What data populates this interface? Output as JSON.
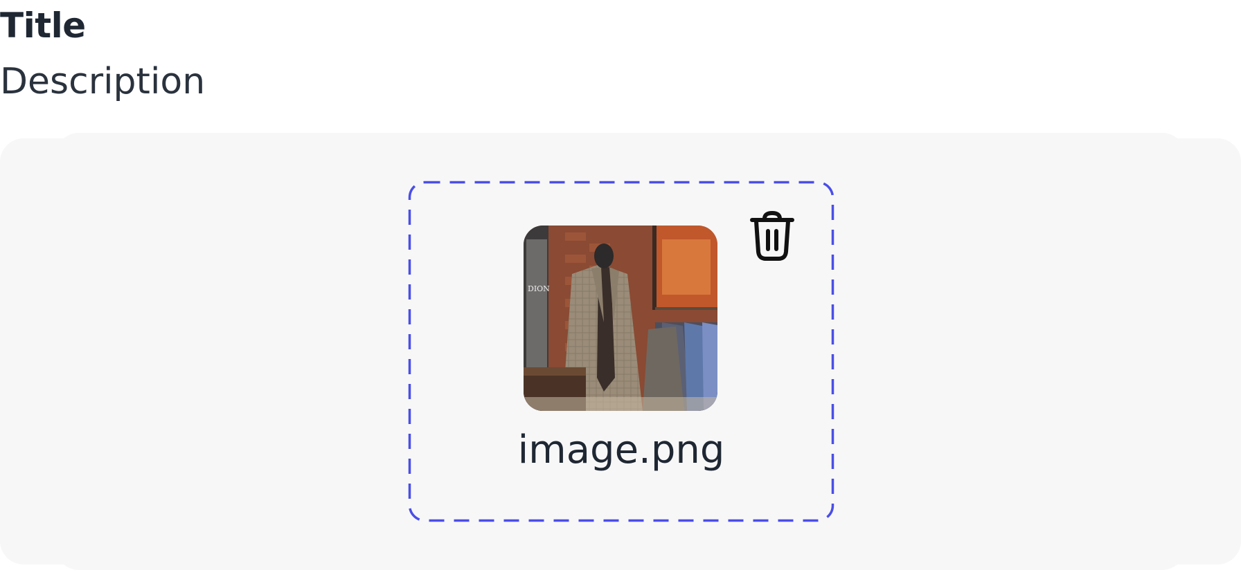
{
  "header": {
    "title": "Title",
    "description": "Description"
  },
  "uploader": {
    "file": {
      "name": "image.png",
      "thumbnail_subject": "suit on mannequin in tailor shop",
      "thumbnail_sign_text": "DION"
    },
    "delete_icon": "trash-icon"
  },
  "colors": {
    "dashed_border": "#4a4ee8",
    "area_background": "#f7f7f7",
    "text_primary": "#1f2733"
  }
}
